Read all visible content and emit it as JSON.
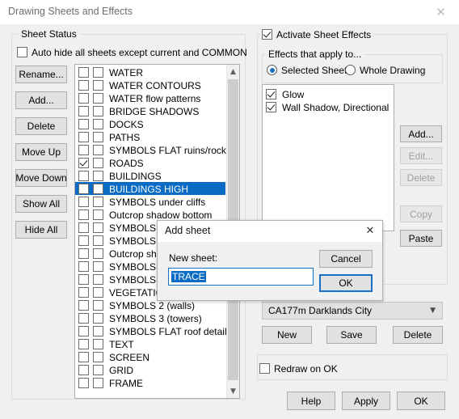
{
  "window": {
    "title": "Drawing Sheets and Effects",
    "close_icon": "close-icon"
  },
  "sheet_status": {
    "group_label": "Sheet Status",
    "auto_hide": {
      "label": "Auto hide all sheets except current and COMMON",
      "checked": false
    },
    "buttons": [
      {
        "label": "Rename...",
        "enabled": true
      },
      {
        "label": "Add...",
        "enabled": true
      },
      {
        "label": "Delete",
        "enabled": true
      },
      {
        "label": "Move Up",
        "enabled": true
      },
      {
        "label": "Move Down",
        "enabled": true
      },
      {
        "label": "Show All",
        "enabled": true
      },
      {
        "label": "Hide All",
        "enabled": true
      }
    ],
    "sheets": [
      {
        "name": "WATER",
        "col1": false,
        "col2": false,
        "selected": false
      },
      {
        "name": "WATER CONTOURS",
        "col1": false,
        "col2": false,
        "selected": false
      },
      {
        "name": "WATER flow patterns",
        "col1": false,
        "col2": false,
        "selected": false
      },
      {
        "name": "BRIDGE SHADOWS",
        "col1": false,
        "col2": false,
        "selected": false
      },
      {
        "name": "DOCKS",
        "col1": false,
        "col2": false,
        "selected": false
      },
      {
        "name": "PATHS",
        "col1": false,
        "col2": false,
        "selected": false
      },
      {
        "name": "SYMBOLS FLAT ruins/rocks",
        "col1": false,
        "col2": false,
        "selected": false
      },
      {
        "name": "ROADS",
        "col1": true,
        "col2": false,
        "selected": false
      },
      {
        "name": "BUILDINGS",
        "col1": false,
        "col2": false,
        "selected": false
      },
      {
        "name": "BUILDINGS HIGH",
        "col1": false,
        "col2": false,
        "selected": true
      },
      {
        "name": "SYMBOLS under cliffs",
        "col1": false,
        "col2": false,
        "selected": false
      },
      {
        "name": "Outcrop shadow bottom",
        "col1": false,
        "col2": false,
        "selected": false
      },
      {
        "name": "SYMBOLS O",
        "col1": false,
        "col2": false,
        "selected": false
      },
      {
        "name": "SYMBOLS m",
        "col1": false,
        "col2": false,
        "selected": false
      },
      {
        "name": "Outcrop sha",
        "col1": false,
        "col2": false,
        "selected": false
      },
      {
        "name": "SYMBOLS O",
        "col1": false,
        "col2": false,
        "selected": false
      },
      {
        "name": "SYMBOLS",
        "col1": false,
        "col2": false,
        "selected": false
      },
      {
        "name": "VEGETATION",
        "col1": false,
        "col2": false,
        "selected": false
      },
      {
        "name": "SYMBOLS 2 (walls)",
        "col1": false,
        "col2": false,
        "selected": false
      },
      {
        "name": "SYMBOLS 3 (towers)",
        "col1": false,
        "col2": false,
        "selected": false
      },
      {
        "name": "SYMBOLS FLAT roof details",
        "col1": false,
        "col2": false,
        "selected": false
      },
      {
        "name": "TEXT",
        "col1": false,
        "col2": false,
        "selected": false
      },
      {
        "name": "SCREEN",
        "col1": false,
        "col2": false,
        "selected": false
      },
      {
        "name": "GRID",
        "col1": false,
        "col2": false,
        "selected": false
      },
      {
        "name": "FRAME",
        "col1": false,
        "col2": false,
        "selected": false
      }
    ],
    "scroll_up_icon": "chevron-up-icon",
    "scroll_down_icon": "chevron-down-icon"
  },
  "sheet_effects": {
    "activate": {
      "label": "Activate Sheet Effects",
      "checked": true
    },
    "applies_label": "Effects that apply to...",
    "radios": [
      {
        "label": "Selected Sheet",
        "checked": true
      },
      {
        "label": "Whole Drawing",
        "checked": false
      }
    ],
    "effects": [
      {
        "label": "Glow",
        "checked": true
      },
      {
        "label": "Wall Shadow, Directional",
        "checked": true
      }
    ],
    "effect_buttons": [
      {
        "label": "Add...",
        "enabled": true
      },
      {
        "label": "Edit...",
        "enabled": false
      },
      {
        "label": "Delete",
        "enabled": false
      },
      {
        "label": "Copy",
        "enabled": false
      },
      {
        "label": "Paste",
        "enabled": true
      }
    ],
    "preset": {
      "value": "CA177m Darklands City",
      "arrow_icon": "chevron-down-icon"
    },
    "preset_buttons": [
      {
        "label": "New",
        "enabled": true
      },
      {
        "label": "Save",
        "enabled": true
      },
      {
        "label": "Delete",
        "enabled": true
      }
    ],
    "redraw": {
      "label": "Redraw on OK",
      "checked": false
    }
  },
  "footer_buttons": [
    {
      "label": "Help",
      "enabled": true
    },
    {
      "label": "Apply",
      "enabled": true
    },
    {
      "label": "OK",
      "enabled": true
    }
  ],
  "add_sheet_dialog": {
    "title": "Add sheet",
    "close_icon": "close-icon",
    "field_label": "New sheet:",
    "field_value": "TRACE",
    "cancel_label": "Cancel",
    "ok_label": "OK"
  }
}
